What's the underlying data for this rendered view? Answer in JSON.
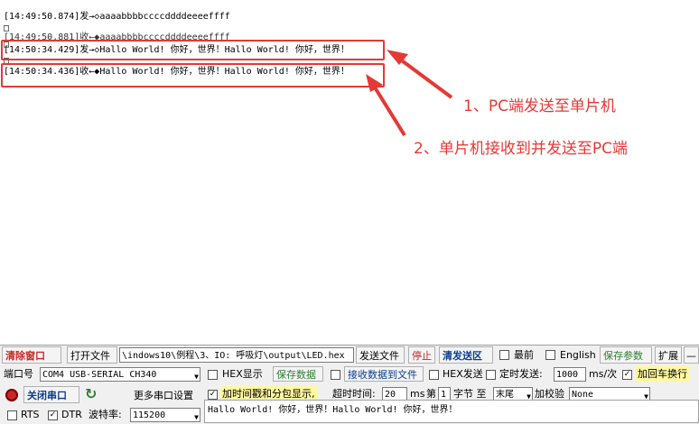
{
  "log": {
    "lines": [
      "[14:49:50.874]发→◇aaaabbbbccccddddeeeeffff",
      "[14:49:50.881]收←◆aaaabbbbccccddddeeeeffff",
      "[14:50:34.429]发→◇Hallo World! 你好，世界！Hallo World! 你好，世界！",
      "[14:50:34.436]收←◆Hallo World! 你好，世界！Hallo World! 你好，世界！"
    ],
    "box_char": "□"
  },
  "annotations": {
    "first": "1、PC端发送至单片机",
    "second": "2、单片机接收到并发送至PC端",
    "color": "#e53935"
  },
  "toolbar": {
    "clear_window": "清除窗口",
    "open_file": "打开文件",
    "file_path": "\\indows10\\例程\\3、IO: 呼吸灯\\output\\LED.hex",
    "send_file": "发送文件",
    "stop": "停止",
    "clear_send": "清发送区",
    "front_label": "最前",
    "english_label": "English",
    "save_params": "保存参数",
    "expand": "扩展",
    "minus": "—"
  },
  "port": {
    "port_label": "端口号",
    "port_value": "COM4 USB-SERIAL CH340",
    "hex_display": "HEX显示",
    "save_data": "保存数据",
    "recv_to_file": "接收数据到文件",
    "hex_send": "HEX发送",
    "timed_send": "定时发送:",
    "interval": "1000",
    "interval_unit": "ms/次",
    "add_crlf": "加回车换行",
    "close_port": "关闭串口",
    "more_settings": "更多串口设置",
    "timestamp_label": "加时间戳和分包显示,",
    "timeout_label": "超时时间:",
    "timeout_value": "20",
    "timeout_unit": "ms",
    "byte_label_pre": "第",
    "byte_value": "1",
    "byte_label_post": "字节 至",
    "end_value": "末尾",
    "checksum_label": "加校验",
    "checksum_value": "None",
    "rts": "RTS",
    "dtr": "DTR",
    "baud_label": "波特率:",
    "baud_value": "115200",
    "send_text": "Hallo World! 你好，世界！Hallo World! 你好，世界！"
  }
}
